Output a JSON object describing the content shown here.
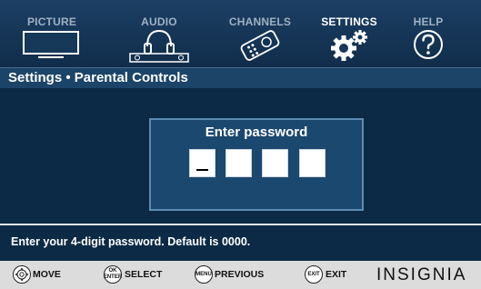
{
  "menu": {
    "tabs": [
      {
        "label": "PICTURE",
        "icon": "tv-icon"
      },
      {
        "label": "AUDIO",
        "icon": "headphones-icon"
      },
      {
        "label": "CHANNELS",
        "icon": "remote-icon"
      },
      {
        "label": "SETTINGS",
        "icon": "gears-icon"
      },
      {
        "label": "HELP",
        "icon": "question-icon"
      }
    ],
    "active_tab": "SETTINGS"
  },
  "title": "Settings • Parental Controls",
  "password_dialog": {
    "title": "Enter password",
    "digit_count": 4,
    "digits": [
      "",
      "",
      "",
      ""
    ],
    "cursor_position": 1
  },
  "hint": "Enter your 4-digit password. Default is 0000.",
  "bottom_bar": {
    "move": {
      "button": "",
      "label": "MOVE"
    },
    "select": {
      "button_top": "OK",
      "button_bottom": "ENTER",
      "label": "SELECT"
    },
    "previous": {
      "button": "MENU",
      "label": "PREVIOUS"
    },
    "exit": {
      "button": "EXIT",
      "label": "EXIT"
    },
    "brand": "INSIGNIA"
  },
  "colors": {
    "background": "#0c2a45",
    "menu_bar": "#163959",
    "title_bar": "#1c4468",
    "dialog": "#1b486f",
    "bottom_bar": "#dcdcdc"
  }
}
